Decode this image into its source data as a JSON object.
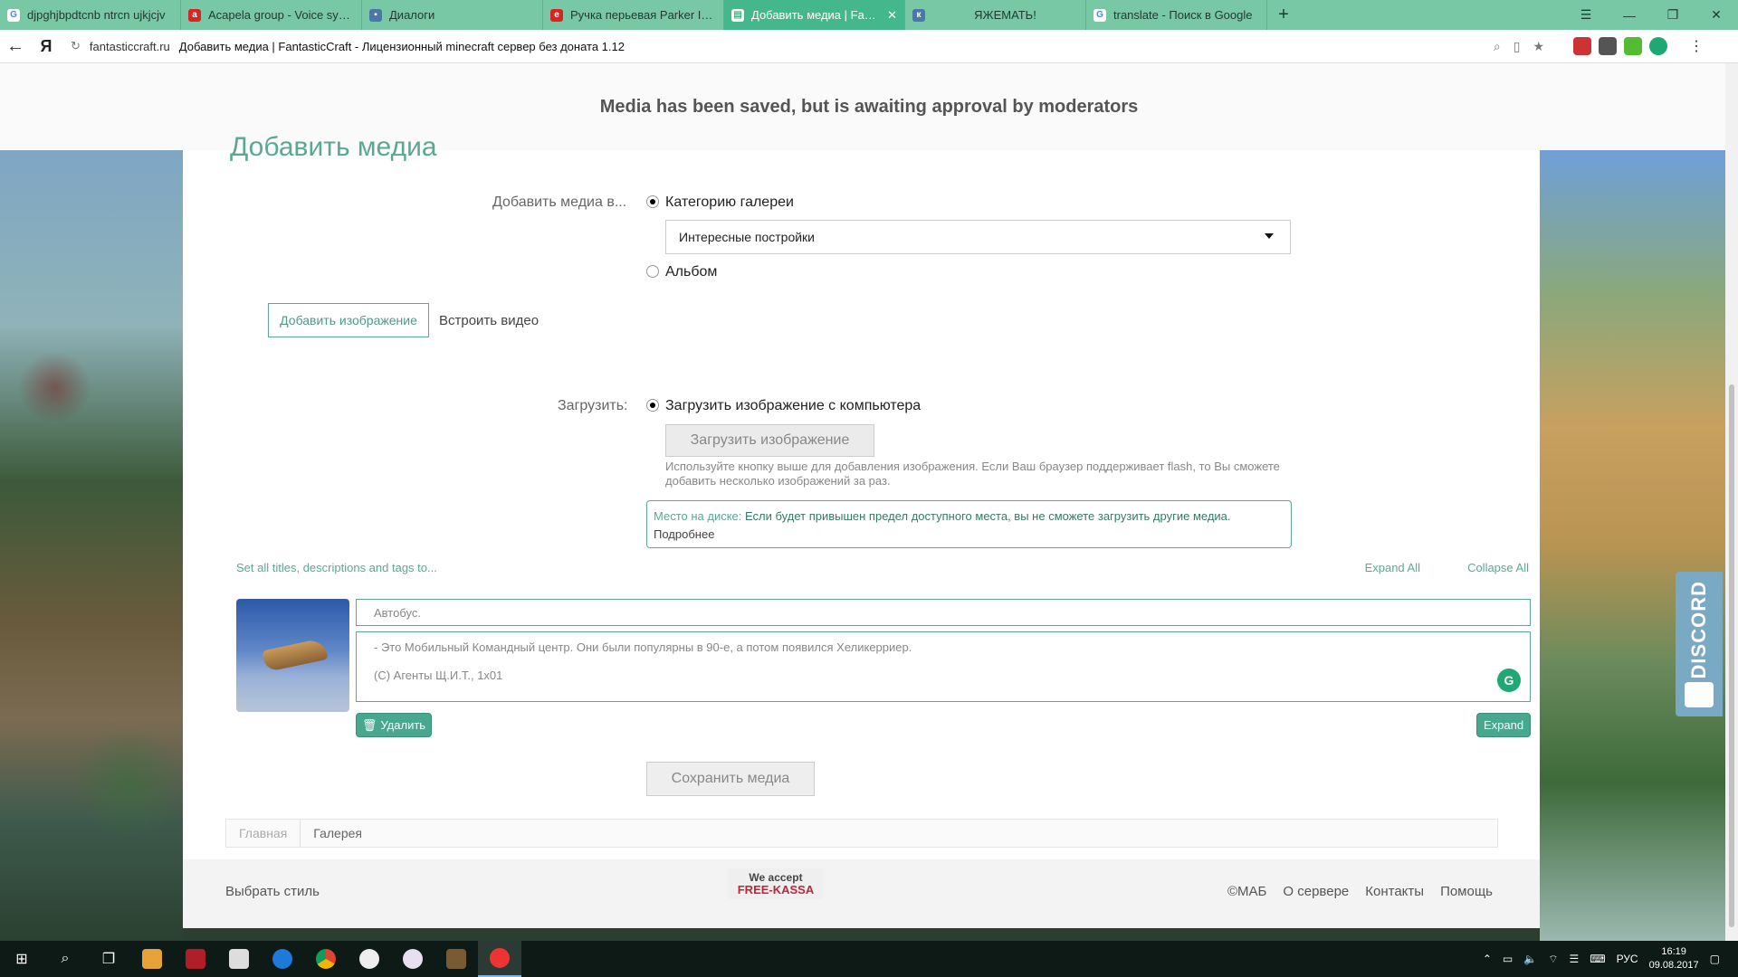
{
  "browser": {
    "tabs": [
      {
        "title": "djpghjbpdtcnb ntrcn ujkjcjv",
        "icon": "google-icon",
        "color": "#ffffff"
      },
      {
        "title": "Acapela group - Voice synth",
        "icon": "acapela-icon",
        "color": "#d22"
      },
      {
        "title": "Диалоги",
        "icon": "vk-icon",
        "color": "#4a76a8"
      },
      {
        "title": "Ручка перьевая Parker IM М",
        "icon": "e-icon",
        "color": "#d22"
      },
      {
        "title": "Добавить медиа | Fantas",
        "icon": "page-icon",
        "color": "#ffffff",
        "active": true
      },
      {
        "title": "ЯЖЕМАТЬ!",
        "icon": "vk-icon",
        "color": "#4a76a8"
      },
      {
        "title": "translate - Поиск в Google",
        "icon": "google-icon",
        "color": "#ffffff"
      }
    ],
    "new_tab": "+",
    "window_buttons": [
      "☰",
      "—",
      "❐",
      "✕"
    ],
    "address": {
      "domain": "fantasticcraft.ru",
      "page_title": "Добавить медиа | FantasticCraft - Лицензионный minecraft сервер без доната 1.12"
    }
  },
  "notice": "Media has been saved, but is awaiting approval by moderators",
  "page": {
    "heading": "Добавить медиа",
    "add_to_label": "Добавить медиа в...",
    "option_category": "Категорию галереи",
    "category_select": "Интересные постройки",
    "option_album": "Альбом",
    "tab_add_image": "Добавить изображение",
    "tab_embed_video": "Встроить видео",
    "upload_label": "Загрузить:",
    "upload_option": "Загрузить изображение с компьютера",
    "upload_button": "Загрузить изображение",
    "upload_hint": "Используйте кнопку выше для добавления изображения. Если Ваш браузер поддерживает flash, то Вы сможете добавить несколько изображений за раз.",
    "disk_key": "Место на диске:",
    "disk_value": "Если будет привышен предел доступного места, вы не сможете загрузить другие медиа.",
    "disk_more": "Подробнее",
    "set_all": "Set all titles, descriptions and tags to...",
    "expand_all": "Expand All",
    "collapse_all": "Collapse All",
    "item": {
      "title": "Автобус.",
      "desc_line1": "- Это Мобильный Командный центр. Они были популярны в 90-е, а потом появился Хеликерриер.",
      "desc_line2": "(С) Агенты Щ.И.Т., 1х01",
      "delete": "Удалить",
      "expand": "Expand"
    },
    "save_button": "Сохранить медиа",
    "breadcrumbs": [
      "Главная",
      "Галерея"
    ]
  },
  "footer": {
    "style": "Выбрать стиль",
    "kassa_line1": "We accept",
    "kassa_line2": "FREE-KASSA",
    "links": [
      "©МАБ",
      "О сервере",
      "Контакты",
      "Помощь"
    ]
  },
  "discord": "DISCORD",
  "taskbar": {
    "lang": "РУС",
    "time": "16:19",
    "date": "09.08.2017"
  },
  "colors": {
    "accent": "#5aa894",
    "tabbar": "#78c8a5"
  }
}
